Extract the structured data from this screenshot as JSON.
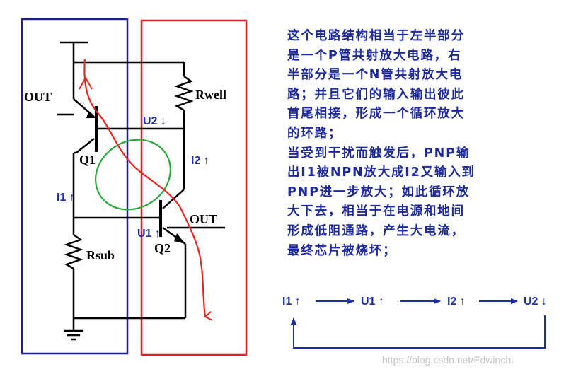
{
  "circuit": {
    "labels": {
      "out_left": "OUT",
      "out_right": "OUT",
      "rwell": "Rwell",
      "rsub": "Rsub",
      "q1": "Q1",
      "q2": "Q2",
      "u2": "U2 ↓",
      "i2": "I2 ↑",
      "i1": "I1 ↑",
      "u1": "U1 ↑"
    },
    "colors": {
      "left_box": "#1f1f8f",
      "right_box": "#d81f2a",
      "wire": "#000000",
      "current_path": "#e8261f",
      "loop_ellipse": "#2aa83a"
    }
  },
  "explanation": {
    "lines": [
      "这个电路结构相当于左半部分",
      "是一个P管共射放大电路，右",
      "半部分是一个N管共射放大电",
      "路；并且它们的输入输出彼此",
      "首尾相接，形成一个循环放大",
      "的环路；",
      "当受到干扰而触发后，PNP输",
      "出I1被NPN放大成I2又输入到",
      "PNP进一步放大；如此循环放",
      "大下去，相当于在电源和地间",
      "形成低阻通路，产生大电流，",
      "最终芯片被烧坏；"
    ]
  },
  "chain": {
    "items": [
      "I1 ↑",
      "U1 ↑",
      "I2 ↑",
      "U2 ↓"
    ]
  },
  "watermark": "https://blog.csdn.net/Edwinchi"
}
